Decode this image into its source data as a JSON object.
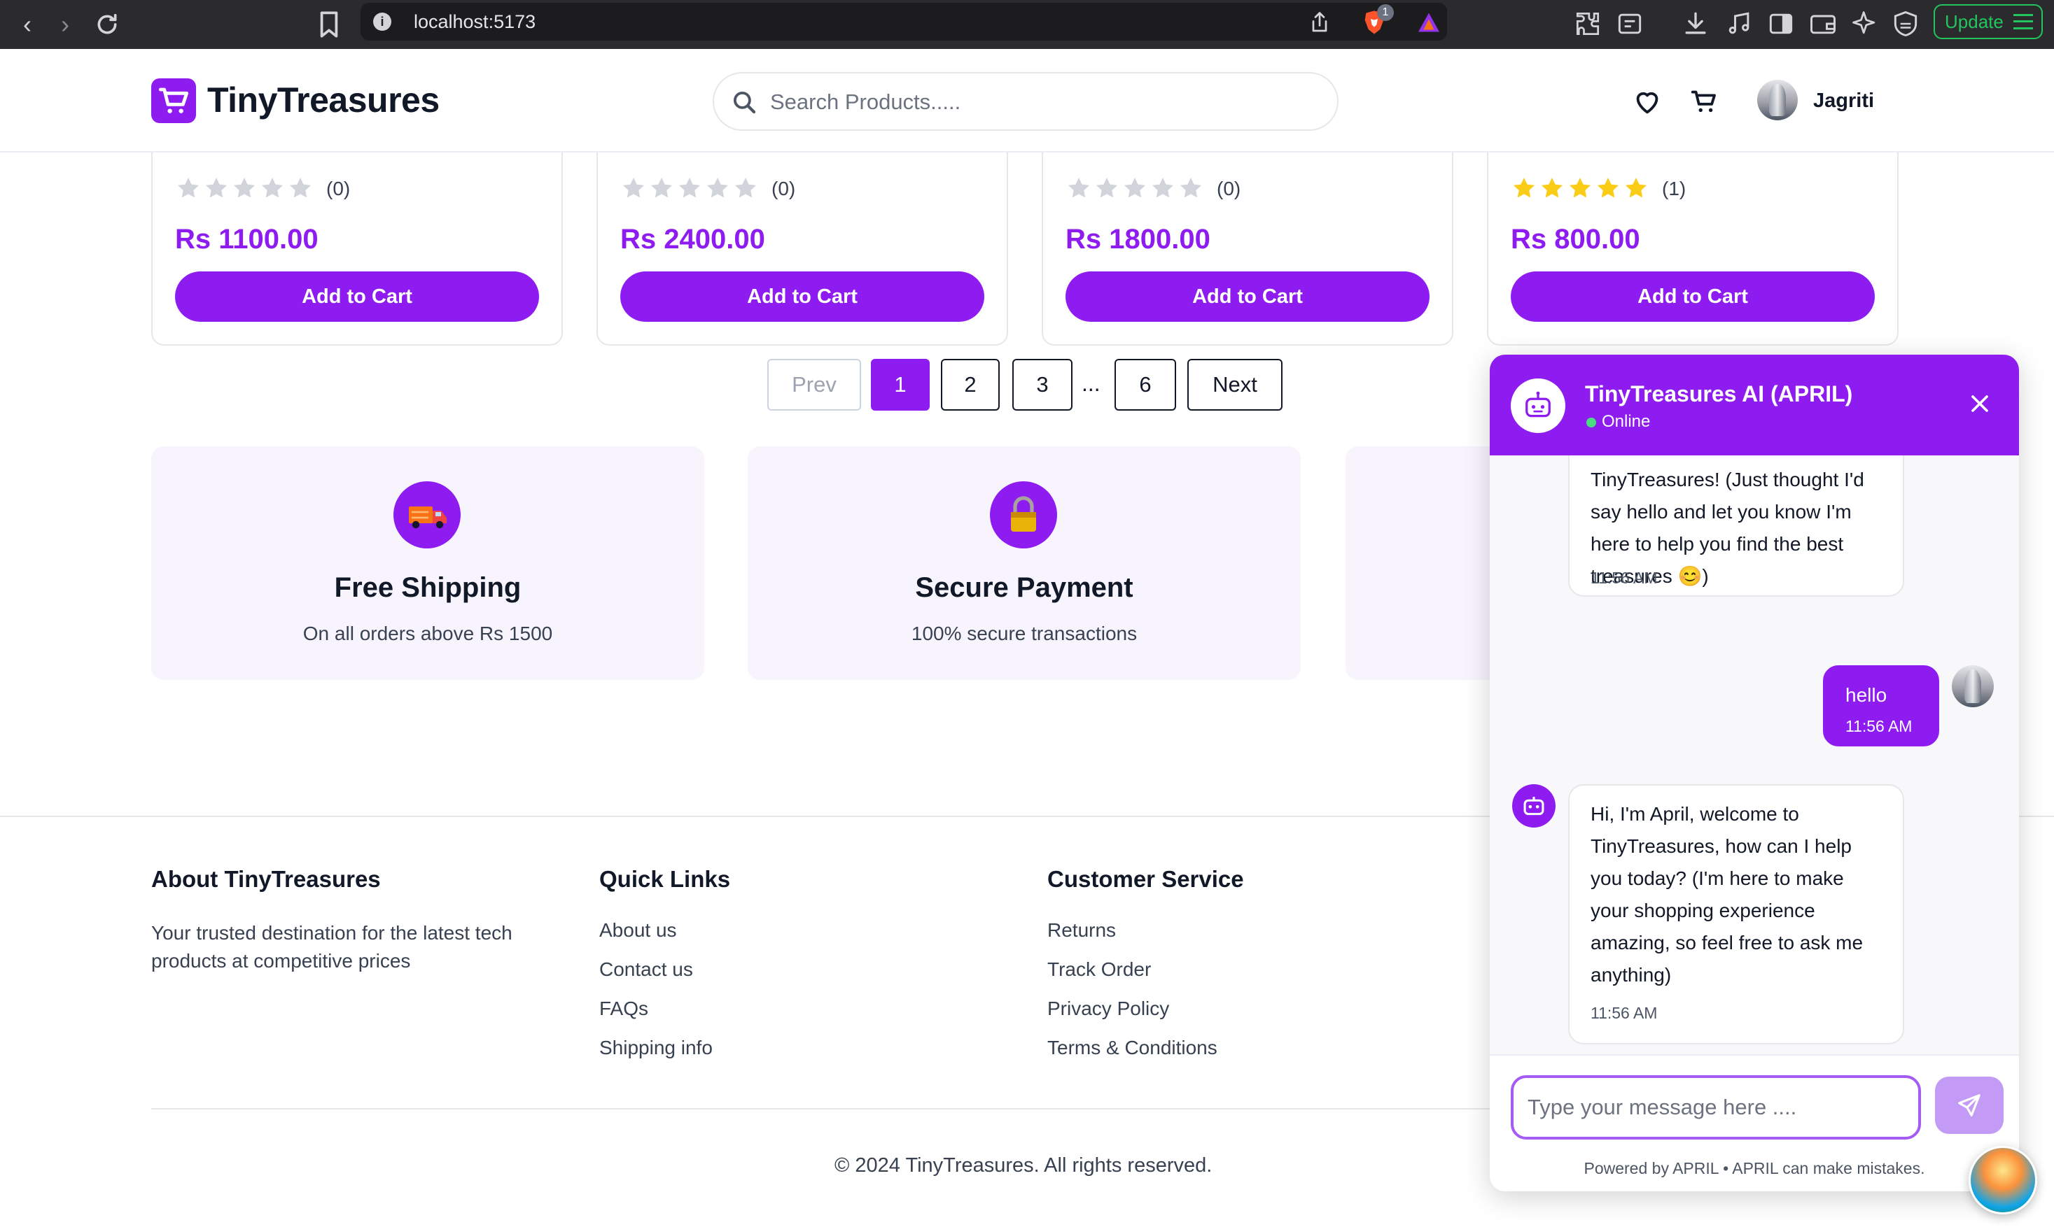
{
  "browser": {
    "url": "localhost:5173",
    "brave_badge": "1",
    "update_label": "Update"
  },
  "header": {
    "brand": "TinyTreasures",
    "search_placeholder": "Search Products.....",
    "user_name": "Jagriti"
  },
  "products": [
    {
      "rating": 0,
      "reviews": "(0)",
      "price": "Rs 1100.00",
      "button": "Add to Cart"
    },
    {
      "rating": 0,
      "reviews": "(0)",
      "price": "Rs 2400.00",
      "button": "Add to Cart"
    },
    {
      "rating": 0,
      "reviews": "(0)",
      "price": "Rs 1800.00",
      "button": "Add to Cart"
    },
    {
      "rating": 5,
      "reviews": "(1)",
      "price": "Rs 800.00",
      "button": "Add to Cart"
    }
  ],
  "pagination": {
    "prev": "Prev",
    "pages": [
      "1",
      "2",
      "3",
      "6"
    ],
    "ellipsis": "...",
    "next": "Next",
    "current": "1"
  },
  "features": [
    {
      "title": "Free Shipping",
      "desc": "On all orders above Rs 1500",
      "icon": "delivery-truck-icon"
    },
    {
      "title": "Secure Payment",
      "desc": "100% secure transactions",
      "icon": "lock-icon"
    }
  ],
  "footer": {
    "about_title": "About TinyTreasures",
    "about_text": "Your trusted destination for the latest tech products at competitive prices",
    "quick_title": "Quick Links",
    "quick_links": [
      "About us",
      "Contact us",
      "FAQs",
      "Shipping info"
    ],
    "service_title": "Customer Service",
    "service_links": [
      "Returns",
      "Track Order",
      "Privacy Policy",
      "Terms & Conditions"
    ],
    "copyright": "© 2024 TinyTreasures. All rights reserved."
  },
  "chat": {
    "title": "TinyTreasures AI (APRIL)",
    "status": "Online",
    "messages": [
      {
        "from": "bot",
        "lines": [
          "TinyTreasures! (Just thought I'd",
          "say hello and let you know I'm",
          "here to help you find the best",
          "treasures 😊)"
        ],
        "time": "11:56 AM"
      },
      {
        "from": "user",
        "lines": [
          "hello"
        ],
        "time": "11:56 AM"
      },
      {
        "from": "bot",
        "lines": [
          "Hi, I'm April, welcome to",
          "TinyTreasures, how can I help",
          "you today? (I'm here to make",
          "your shopping experience",
          "amazing, so feel free to ask me",
          "anything)"
        ],
        "time": "11:56 AM"
      }
    ],
    "input_placeholder": "Type your message here ....",
    "powered_by": "Powered by APRIL • APRIL can make mistakes."
  },
  "colors": {
    "brand": "#8e1cf0",
    "feature_bg": "#f7f4fd",
    "star_filled": "#facc15",
    "star_empty": "#d1d5db",
    "online": "#4ade80"
  }
}
